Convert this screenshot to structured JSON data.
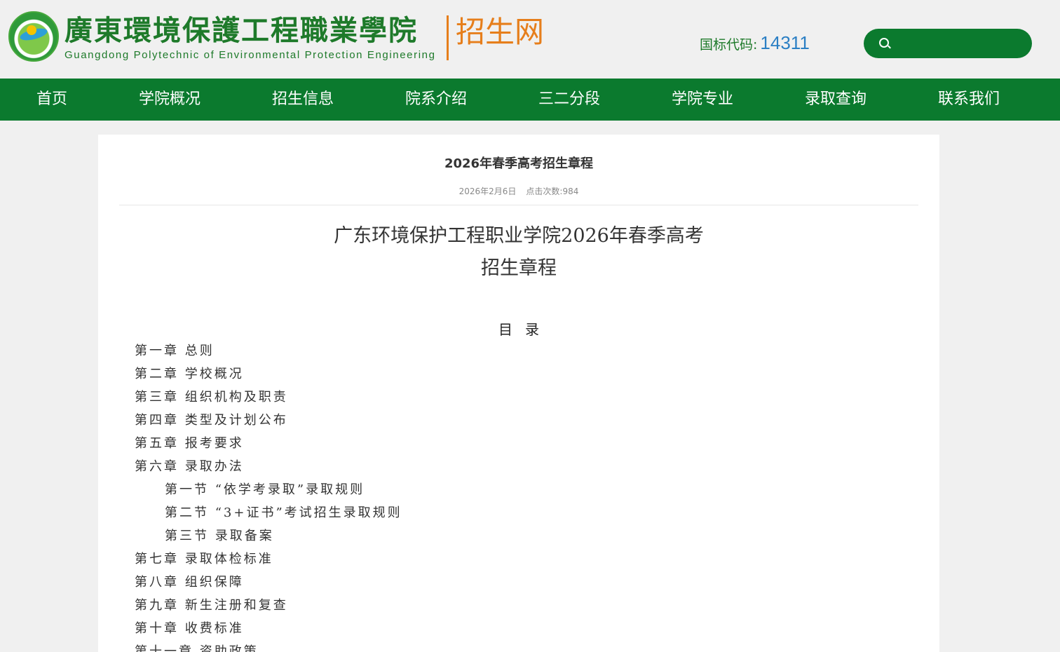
{
  "header": {
    "school_name": "廣東環境保護工程職業學院",
    "school_name_en": "Guangdong Polytechnic of Environmental Protection Engineering",
    "site_name": "招生网",
    "code_label": "国标代码:",
    "code_value": "14311",
    "search_placeholder": ""
  },
  "nav": {
    "items": [
      {
        "label": "首页"
      },
      {
        "label": "学院概况"
      },
      {
        "label": "招生信息"
      },
      {
        "label": "院系介绍"
      },
      {
        "label": "三二分段"
      },
      {
        "label": "学院专业"
      },
      {
        "label": "录取查询"
      },
      {
        "label": "联系我们"
      }
    ]
  },
  "article": {
    "title": "2026年春季高考招生章程",
    "date": "2026年2月6日",
    "views": "点击次数:984",
    "doc_title_line1": "广东环境保护工程职业学院2026年春季高考",
    "doc_title_line2": "招生章程",
    "toc_heading": "目录",
    "toc": [
      {
        "text": "第一章  总则",
        "sub": false
      },
      {
        "text": "第二章  学校概况",
        "sub": false
      },
      {
        "text": "第三章  组织机构及职责",
        "sub": false
      },
      {
        "text": "第四章  类型及计划公布",
        "sub": false
      },
      {
        "text": "第五章  报考要求",
        "sub": false
      },
      {
        "text": "第六章  录取办法",
        "sub": false
      },
      {
        "text": "第一节  “依学考录取”录取规则",
        "sub": true
      },
      {
        "text": "第二节  “3+证书”考试招生录取规则",
        "sub": true
      },
      {
        "text": "第三节  录取备案",
        "sub": true
      },
      {
        "text": "第七章  录取体检标准",
        "sub": false
      },
      {
        "text": "第八章  组织保障",
        "sub": false
      },
      {
        "text": "第九章  新生注册和复查",
        "sub": false
      },
      {
        "text": "第十章  收费标准",
        "sub": false
      },
      {
        "text": "第十一章  资助政策",
        "sub": false
      }
    ]
  },
  "colors": {
    "brand_green": "#0b7a2e",
    "accent_orange": "#e67e1b",
    "code_blue": "#2b7fc4"
  }
}
